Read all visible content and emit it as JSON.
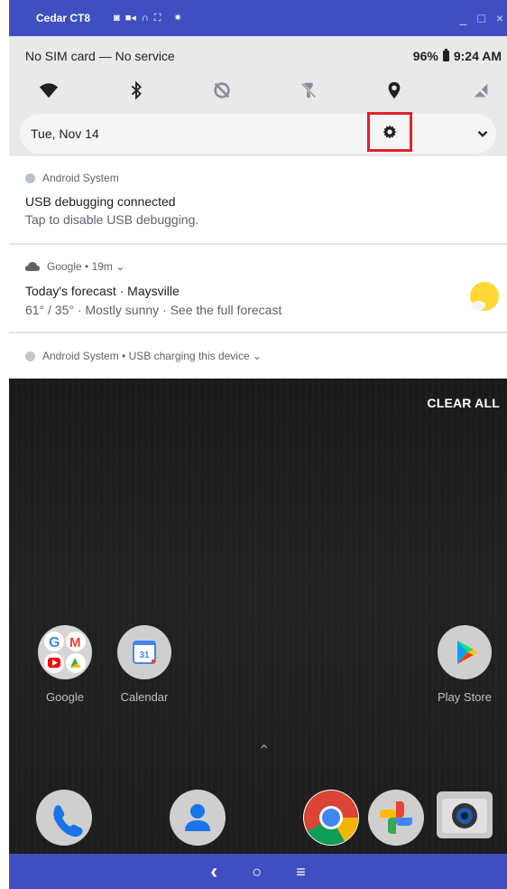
{
  "window": {
    "title": "Cedar CT8",
    "tool_icons": [
      "camera-icon",
      "video-icon",
      "headset-icon",
      "fullscreen-icon",
      "settings-icon"
    ],
    "controls": [
      "minimize-icon",
      "maximize-icon",
      "close-icon"
    ]
  },
  "status_bar": {
    "carrier": "No SIM card — No service",
    "battery": "96%",
    "time": "9:24 AM"
  },
  "quick_settings": {
    "tiles": [
      {
        "name": "wifi",
        "icon": "wifi-icon"
      },
      {
        "name": "bluetooth",
        "icon": "bluetooth-icon"
      },
      {
        "name": "auto-rotate-off",
        "icon": "rotate-off-icon"
      },
      {
        "name": "flashlight-off",
        "icon": "flashlight-off-icon"
      },
      {
        "name": "location",
        "icon": "location-icon"
      },
      {
        "name": "mobile-data-off",
        "icon": "mobile-data-off-icon"
      }
    ],
    "date": "Tue, Nov 14",
    "settings_icon": "gear-icon",
    "highlight_color": "#e3202d"
  },
  "notifications": [
    {
      "app": "Android System",
      "title": "USB debugging connected",
      "body": "Tap to disable USB debugging."
    },
    {
      "app": "Google",
      "meta": " • 19m ⌄",
      "title": "Today's forecast · Maysville",
      "body": "61° / 35° · Mostly sunny · See the full forecast"
    },
    {
      "app": "Android System",
      "meta": " • USB charging this device ⌄"
    }
  ],
  "home": {
    "clear_all": "CLEAR ALL",
    "apps": [
      {
        "label": "Google"
      },
      {
        "label": "Calendar",
        "icon_text": "31"
      },
      {
        "label": "Play Store"
      }
    ],
    "dock": [
      "phone-icon",
      "contacts-icon",
      "chrome-icon",
      "photos-icon",
      "camera-icon"
    ]
  },
  "nav_bar": {
    "back": "‹",
    "home": "○",
    "menu": "≡"
  },
  "colors": {
    "frame_blue": "#3f4fc2",
    "shade_bg": "#e9e9e9",
    "home_bg": "#1b1b1b"
  }
}
